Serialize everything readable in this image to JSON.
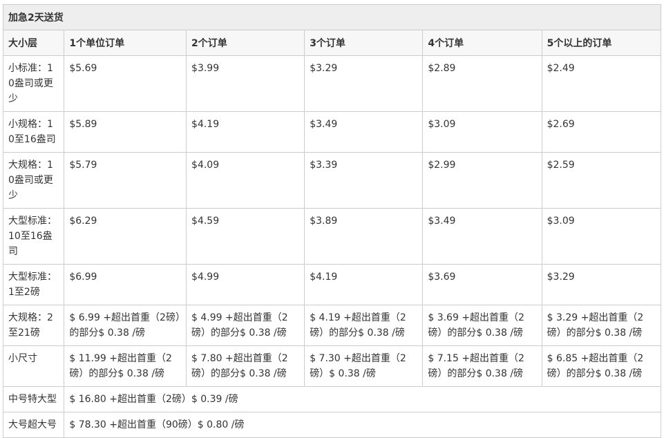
{
  "title": "加急2天送货",
  "columns": [
    "大小层",
    "1个单位订单",
    "2个订单",
    "3个订单",
    "4个订单",
    "5个以上的订单"
  ],
  "rows": [
    [
      "小标准：10盎司或更少",
      "$5.69",
      "$3.99",
      "$3.29",
      "$2.89",
      "$2.49"
    ],
    [
      "小规格：10至16盎司",
      "$5.89",
      "$4.19",
      "$3.49",
      "$3.09",
      "$2.69"
    ],
    [
      "大规格：10盎司或更少",
      "$5.79",
      "$4.09",
      "$3.39",
      "$2.99",
      "$2.59"
    ],
    [
      "大型标准：10至16盎司",
      "$6.29",
      "$4.59",
      "$3.89",
      "$3.49",
      "$3.09"
    ],
    [
      "大型标准：1至2磅",
      "$6.99",
      "$4.99",
      "$4.19",
      "$3.69",
      "$3.29"
    ],
    [
      "大规格：2至21磅",
      "$ 6.99 +超出首重（2磅）的部分$ 0.38 /磅",
      "$ 4.99 +超出首重（2磅）的部分$ 0.38 /磅",
      "$ 4.19 +超出首重（2磅）的部分$ 0.38 /磅",
      "$ 3.69 +超出首重（2磅）的部分$ 0.38 /磅",
      "$ 3.29 +超出首重（2磅）的部分$ 0.38 /磅"
    ],
    [
      "小尺寸",
      "$ 11.99 +超出首重（2磅）的部分$ 0.38 /磅",
      "$ 7.80 +超出首重（2磅）的部分$ 0.38 /磅",
      "$ 7.30 +超出首重（2磅）$ 0.38 /磅",
      "$ 7.15 +超出首重（2磅）的部分$ 0.38 /磅",
      "$ 6.85 +超出首重（2磅）的部分$ 0.38 /磅"
    ]
  ],
  "merged_rows": [
    [
      "中号特大型",
      "$ 16.80 +超出首重（2磅）$ 0.39 /磅"
    ],
    [
      "大号超大号",
      "$ 78.30 +超出首重（90磅）$ 0.80 /磅"
    ]
  ]
}
